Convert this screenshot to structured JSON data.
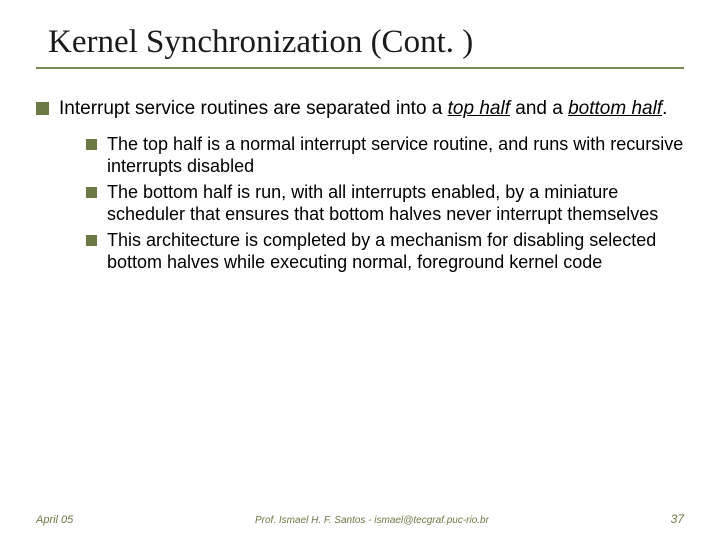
{
  "title": "Kernel Synchronization (Cont. )",
  "main_bullet": {
    "pre": "Interrupt service routines are separated into a ",
    "em1": "top half",
    "mid": " and a ",
    "em2": "bottom half",
    "post": "."
  },
  "sub_bullets": [
    "The top half is a normal interrupt service routine, and runs with recursive interrupts disabled",
    "The bottom half is run, with all interrupts enabled, by a miniature scheduler that ensures that bottom halves never interrupt themselves",
    "This architecture is completed by a mechanism for disabling selected bottom halves while executing normal, foreground kernel code"
  ],
  "footer": {
    "date": "April 05",
    "center": "Prof. Ismael H. F. Santos - ismael@tecgraf.puc-rio.br",
    "page": "37"
  }
}
